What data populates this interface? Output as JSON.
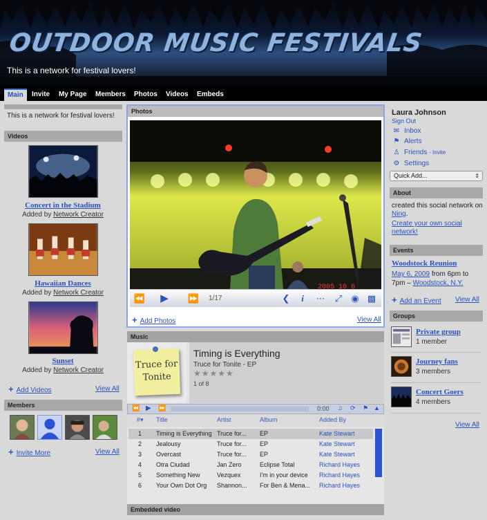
{
  "site": {
    "title": "OUTDOOR MUSIC FESTIVALS",
    "tagline": "This is a network for festival lovers!"
  },
  "nav": {
    "tabs": [
      "Main",
      "Invite",
      "My Page",
      "Members",
      "Photos",
      "Videos",
      "Embeds"
    ],
    "active": "Main"
  },
  "left": {
    "welcome": "This is a network for festival lovers!",
    "videos_head": "Videos",
    "videos": [
      {
        "title": "Concert in the Stadium",
        "added_by_prefix": "Added by",
        "creator": "Network Creator"
      },
      {
        "title": "Hawaiian Dances",
        "added_by_prefix": "Added by",
        "creator": "Network Creator"
      },
      {
        "title": "Sunset",
        "added_by_prefix": "Added by",
        "creator": "Network Creator"
      }
    ],
    "add_videos": "Add Videos",
    "view_all": "View All",
    "members_head": "Members",
    "invite_more": "Invite More"
  },
  "photos": {
    "head": "Photos",
    "counter": "1/17",
    "add_photos": "Add Photos",
    "view_all": "View All",
    "overlay_text": "2005 10 6"
  },
  "music": {
    "head": "Music",
    "album_note": "Truce for Tonite",
    "track_title": "Timing is Everything",
    "track_album": "Truce for Tonite - EP",
    "stars": "★★★★★",
    "position": "1 of 8",
    "time": "0:00",
    "columns": {
      "num": "#",
      "title": "Title",
      "artist": "Artist",
      "album": "Album",
      "added_by": "Added By"
    },
    "tracks": [
      {
        "num": "1",
        "title": "Timing is Everything",
        "artist": "Truce for...",
        "album": "EP",
        "added_by": "Kate Stewart"
      },
      {
        "num": "2",
        "title": "Jealousy",
        "artist": "Truce for...",
        "album": "EP",
        "added_by": "Kate Stewart"
      },
      {
        "num": "3",
        "title": "Overcast",
        "artist": "Truce for...",
        "album": "EP",
        "added_by": "Kate Stewart"
      },
      {
        "num": "4",
        "title": "Otra Ciudad",
        "artist": "Jan Zero",
        "album": "Eclipse Total",
        "added_by": "Richard Hayes"
      },
      {
        "num": "5",
        "title": "Something New",
        "artist": "Vezquex",
        "album": "I'm in your device",
        "added_by": "Richard Hayes"
      },
      {
        "num": "6",
        "title": "Your Own Dot Org",
        "artist": "Shannon...",
        "album": "For Ben & Mena...",
        "added_by": "Richard Hayes"
      }
    ]
  },
  "embedded": {
    "head": "Embedded video"
  },
  "right": {
    "user_name": "Laura Johnson",
    "sign_out": "Sign Out",
    "inbox": "Inbox",
    "alerts": "Alerts",
    "friends": "Friends",
    "friends_invite": "- Invite",
    "settings": "Settings",
    "quick_add": "Quick Add...",
    "about_head": "About",
    "about_text": "created this social network on",
    "about_link": "Ning",
    "create_own": "Create your own social network!",
    "events_head": "Events",
    "event_title": "Woodstock Reunion",
    "event_date": "May 6, 2009",
    "event_time_from": "from 6pm to",
    "event_time_to": "7pm –",
    "event_place": "Woodstock, N.Y.",
    "add_event": "Add an Event",
    "view_all": "View All",
    "groups_head": "Groups",
    "groups": [
      {
        "title": "Private group",
        "count": "1 member"
      },
      {
        "title": "Journey fans",
        "count": "3 members"
      },
      {
        "title": "Concert Goers",
        "count": "4 members"
      }
    ],
    "groups_view_all": "View All"
  }
}
